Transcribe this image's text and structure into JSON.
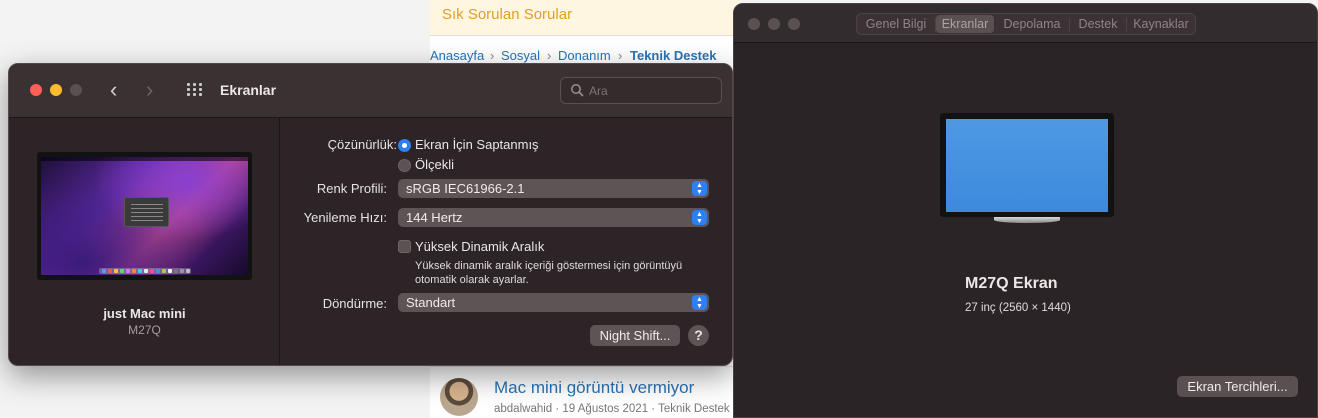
{
  "webpage": {
    "faq_title": "Sık Sorulan Sorular",
    "breadcrumbs": [
      "Anasayfa",
      "Sosyal",
      "Donanım",
      "Teknik Destek"
    ],
    "thread": {
      "title": "Mac mini görüntü vermiyor",
      "meta": "abdalwahid · 19 Ağustos 2021 · Teknik Destek"
    }
  },
  "displays_window": {
    "title": "Ekranlar",
    "search_placeholder": "Ara",
    "mac": {
      "name": "just Mac mini",
      "model": "M27Q"
    },
    "resolution": {
      "label": "Çözünürlük:",
      "options": [
        {
          "label": "Ekran İçin Saptanmış",
          "selected": true
        },
        {
          "label": "Ölçekli",
          "selected": false
        }
      ]
    },
    "color_profile": {
      "label": "Renk Profili:",
      "value": "sRGB IEC61966-2.1"
    },
    "refresh_rate": {
      "label": "Yenileme Hızı:",
      "value": "144 Hertz"
    },
    "hdr": {
      "label": "Yüksek Dinamik Aralık",
      "checked": false,
      "hint_line1": "Yüksek dinamik aralık içeriği göstermesi için görüntüyü",
      "hint_line2": "otomatik olarak ayarlar."
    },
    "rotation": {
      "label": "Döndürme:",
      "value": "Standart"
    },
    "night_shift_button": "Night Shift...",
    "help_button": "?"
  },
  "about_window": {
    "tabs": [
      "Genel Bilgi",
      "Ekranlar",
      "Depolama",
      "Destek",
      "Kaynaklar"
    ],
    "active_tab": "Ekranlar",
    "display_name": "M27Q Ekran",
    "display_size": "27 inç (2560 × 1440)",
    "prefs_button": "Ekran Tercihleri..."
  },
  "colors": {
    "accent": "#2d7ff2",
    "link": "#2a74b7",
    "faq_text": "#e0a020"
  }
}
